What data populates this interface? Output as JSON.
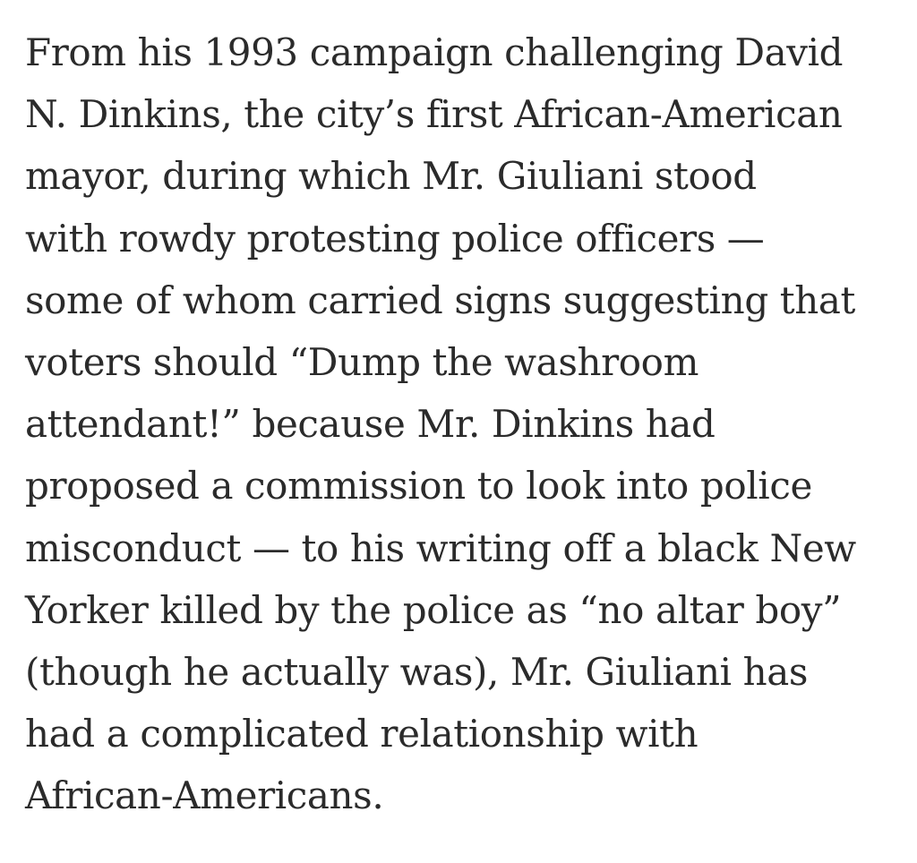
{
  "article": {
    "lines": [
      "From his 1993 campaign challenging David",
      "N. Dinkins, the city’s first African-American",
      "mayor, during which Mr. Giuliani stood",
      "with rowdy protesting police officers —",
      "some of whom carried signs suggesting that",
      "voters should “Dump the washroom",
      "attendant!” because Mr. Dinkins had",
      "proposed a commission to look into police",
      "misconduct — to his writing off a black New",
      "Yorker killed by the police as “no altar boy”",
      "(though he actually was), Mr. Giuliani has",
      "had a complicated relationship with",
      "African-Americans."
    ]
  }
}
